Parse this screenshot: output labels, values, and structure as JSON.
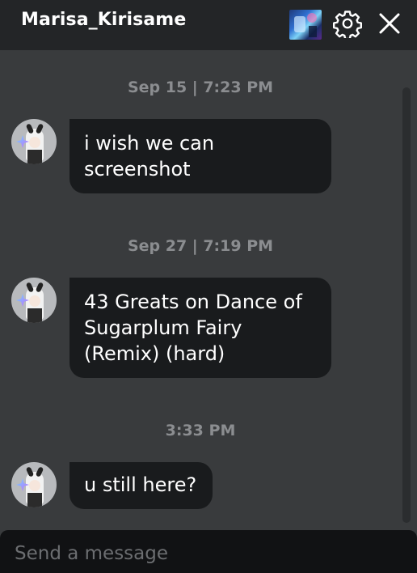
{
  "header": {
    "title": "Marisa_Kirisame"
  },
  "conversation": [
    {
      "timestamp": "Sep 15 | 7:23 PM",
      "message_lines": [
        "i wish we can",
        "screenshot"
      ]
    },
    {
      "timestamp": "Sep 27 | 7:19 PM",
      "message_lines": [
        "43 Greats on Dance of",
        "Sugarplum Fairy",
        "(Remix) (hard)"
      ]
    },
    {
      "timestamp": "3:33 PM",
      "message_lines": [
        "u still here?"
      ]
    }
  ],
  "composer": {
    "placeholder": "Send a message",
    "value": ""
  },
  "icons": {
    "settings": "gear-icon",
    "close": "close-icon"
  },
  "colors": {
    "background": "#393b3d",
    "header": "#232527",
    "bubble": "#191b1d",
    "timestamp": "#8b8d90"
  }
}
